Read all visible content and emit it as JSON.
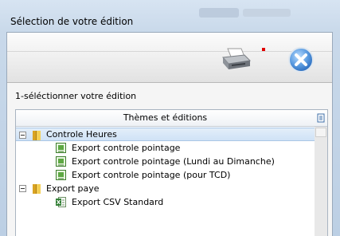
{
  "window": {
    "title": "Sélection de votre édition"
  },
  "section_label": "1-séléctionner votre édition",
  "grid": {
    "header": "Thèmes et éditions",
    "groups": [
      {
        "label": "Controle Heures",
        "selected": true,
        "items": [
          "Export controle pointage",
          "Export controle pointage (Lundi au Dimanche)",
          "Export controle pointage (pour TCD)"
        ]
      },
      {
        "label": "Export paye",
        "items": [
          "Export CSV Standard"
        ]
      }
    ]
  },
  "icons": {
    "printer": "printer-icon",
    "close": "close-icon",
    "folder": "folder-icon",
    "report": "report-icon",
    "csv": "excel-csv-icon",
    "column_chooser": "column-chooser-icon"
  },
  "colors": {
    "accent": "#4f8fd4",
    "selection": "#cfe2f6",
    "close_button": "#5a9be0",
    "marker": "#e00000"
  }
}
